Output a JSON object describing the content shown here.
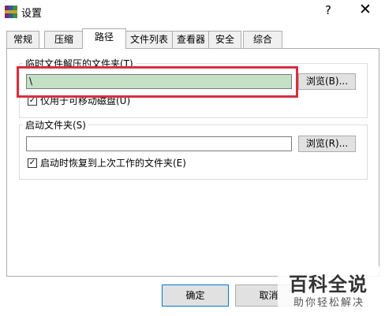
{
  "window": {
    "title": "设置",
    "help_label": "?",
    "close_label": "✕"
  },
  "tabs": [
    {
      "label": "常规"
    },
    {
      "label": "压缩"
    },
    {
      "label": "路径",
      "active": true
    },
    {
      "label": "文件列表"
    },
    {
      "label": "查看器"
    },
    {
      "label": "安全"
    },
    {
      "label": "综合"
    }
  ],
  "temp_group": {
    "label": "临时文件解压的文件夹(T)",
    "path_value": "\\",
    "browse_label": "浏览(B)...",
    "removable_only_label": "仅用于可移动磁盘(U)",
    "removable_only_checked": true
  },
  "startup_group": {
    "label": "启动文件夹(S)",
    "path_value": "",
    "browse_label": "浏览(R)...",
    "restore_label": "启动时恢复到上次工作的文件夹(E)",
    "restore_checked": true
  },
  "footer": {
    "ok_label": "确定",
    "cancel_label": "取消"
  },
  "watermark": {
    "title": "百科全说",
    "subtitle": "助你轻松解决"
  },
  "highlight_color": "#d63040",
  "selection_color": "#c5e1c5"
}
